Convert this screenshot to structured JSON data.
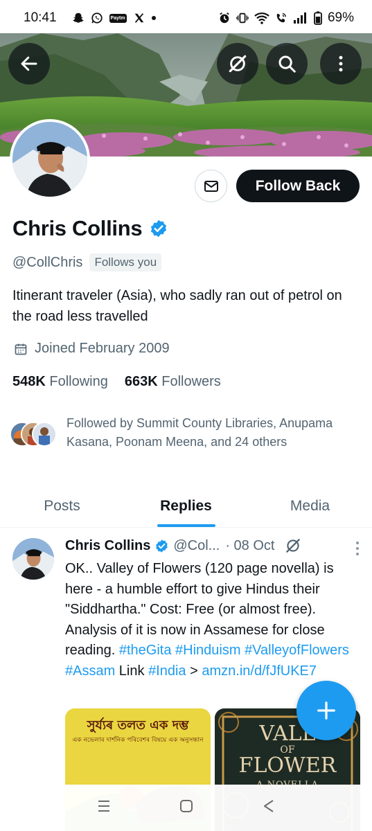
{
  "status_bar": {
    "time": "10:41",
    "battery": "69%"
  },
  "profile": {
    "display_name": "Chris Collins",
    "handle": "@CollChris",
    "follows_you": "Follows you",
    "bio": "Itinerant traveler (Asia), who sadly ran out of petrol on the road less travelled",
    "joined": "Joined February 2009",
    "following_count": "548K",
    "following_label": "Following",
    "followers_count": "663K",
    "followers_label": "Followers",
    "followed_by": "Followed by Summit County Libraries, Anupama Kasana, Poonam Meena, and 24 others",
    "follow_button": "Follow Back"
  },
  "tabs": [
    {
      "label": "Posts",
      "active": false
    },
    {
      "label": "Replies",
      "active": true
    },
    {
      "label": "Media",
      "active": false
    }
  ],
  "tweet": {
    "name": "Chris Collins",
    "handle": "@Col...",
    "date": "· 08 Oct",
    "text_plain_1": "OK.. Valley of Flowers (120 page novella) is here - a humble effort to give Hindus their \"Siddhartha.\" Cost: Free (or almost free). Analysis of it is now in Assamese for close reading. ",
    "hashtag_1": "#theGita",
    "hashtag_2": "#Hinduism",
    "hashtag_3": "#ValleyofFlowers",
    "hashtag_4": "#Assam",
    "text_plain_2": " Link ",
    "hashtag_5": "#India",
    "text_plain_3": " >",
    "link": "amzn.in/d/fJfUKE7",
    "media_1_title": "সুৰ্য্যৰ তলত এক দম্ভ",
    "media_1_subtitle": "এক নভেলাৰ দাৰ্শনিক পৰিবেশৰ বিষয়ে এক অনুসন্ধান",
    "media_2_title_1": "VALL",
    "media_2_title_2": "OF",
    "media_2_title_3": "FLOWER",
    "media_2_subtitle": "A NOVELLA"
  },
  "colors": {
    "accent": "#1d9bf0",
    "text_primary": "#0f1419",
    "text_secondary": "#536471",
    "follow_button_bg": "#0f1419"
  },
  "icons": {
    "back": "arrow-left-icon",
    "grok": "grok-icon",
    "search": "search-icon",
    "more": "more-vertical-icon",
    "message": "mail-icon",
    "calendar": "calendar-icon",
    "verified": "verified-badge-icon",
    "compose": "plus-icon"
  }
}
